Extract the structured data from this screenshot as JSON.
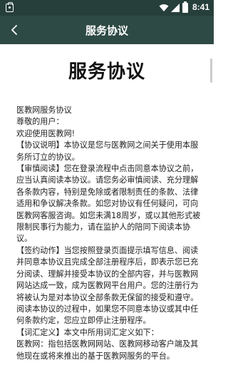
{
  "status_bar": {
    "time": "8:41",
    "icons": [
      "app-notification-icon",
      "wifi-icon",
      "signal-icon",
      "battery-icon"
    ]
  },
  "app_bar": {
    "back_icon": "chevron-left-icon",
    "title": "服务协议"
  },
  "document": {
    "heading": "服务协议",
    "paragraphs": [
      "医教网服务协议",
      "尊敬的用户：",
      "欢迎使用医教网!",
      "【协议说明】本协议是您与医教网之间关于使用本服务所订立的协议。",
      "【审慎阅读】您在登录流程中点击同意本协议之前，应当认真阅读本协议。请您务必审慎阅读、充分理解各条款内容，特别是免除或者限制责任的条款、法律适用和争议解决条款。如您对协议有任何疑问，可向医教网客服咨询。如您未满18周岁，或以其他形式被限制民事行为能力，请在监护人的陪同下阅读本协议。",
      "【签约动作】当您按照登录页面提示填写信息、阅读并同意本协议且完成全部注册程序后，即表示您已充分阅读、理解并接受本协议的全部内容，并与医教网网站达成一致，成为医教网平台用户。您的注册行为将被认为是对本协议全部条款无保留的接受和遵守。阅读本协议的过程中，如果您不同意本协议或其中任何条款约定，您应立即停止注册程序。",
      "【词汇定义】本文中所用词汇定义如下：",
      "医教网：指包括医教网网站、医教网移动客户端及其他现在或将来推出的基于医教网服务的平台。"
    ]
  },
  "colors": {
    "status_bar_bg": "#263f3a",
    "app_bar_bg": "#2e4a44",
    "text": "#222222"
  }
}
